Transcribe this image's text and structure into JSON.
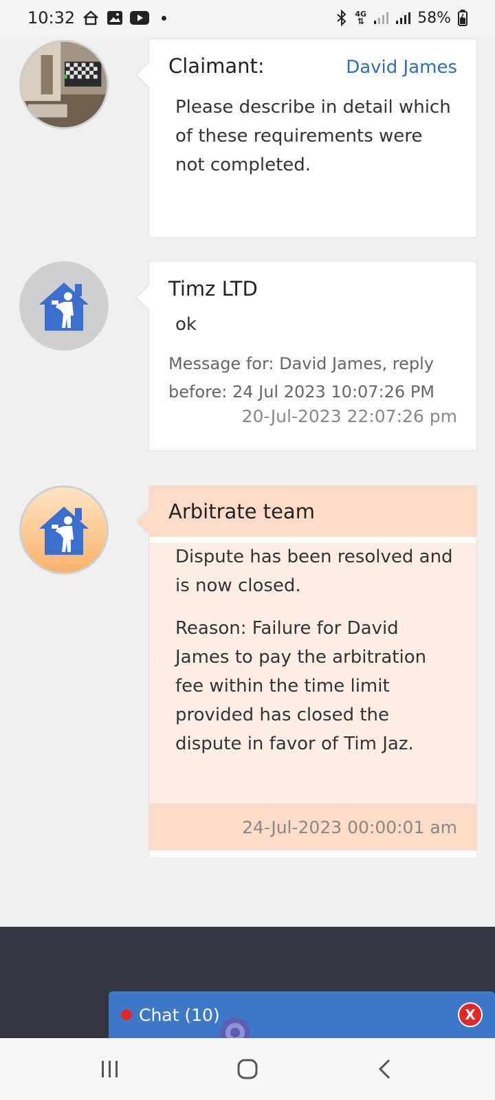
{
  "status_bar": {
    "time": "10:32",
    "network": "4G",
    "battery": "58%"
  },
  "messages": [
    {
      "sender_label": "Claimant:",
      "sender_link": "David James",
      "text": "Please describe in detail which of these requirements were not completed."
    },
    {
      "sender_label": "Timz LTD",
      "text": "ok",
      "meta": "Message for: David James, reply before: 24 Jul 2023 10:07:26 PM",
      "timestamp": "20-Jul-2023 22:07:26 pm"
    },
    {
      "sender_label": "Arbitrate team",
      "text": "Dispute has been resolved and is now closed.",
      "reason": "Reason: Failure for David James to pay the arbitration fee within the time limit provided has closed the dispute in favor of Tim Jaz.",
      "timestamp": "24-Jul-2023 00:00:01 am"
    }
  ],
  "chat": {
    "label": "Chat (10)",
    "close": "X"
  },
  "colors": {
    "accent_blue": "#3e78c8",
    "link_blue": "#2f6fb3",
    "peach": "#fcdcc8",
    "dark_footer": "#333741",
    "alert_red": "#e32626"
  }
}
